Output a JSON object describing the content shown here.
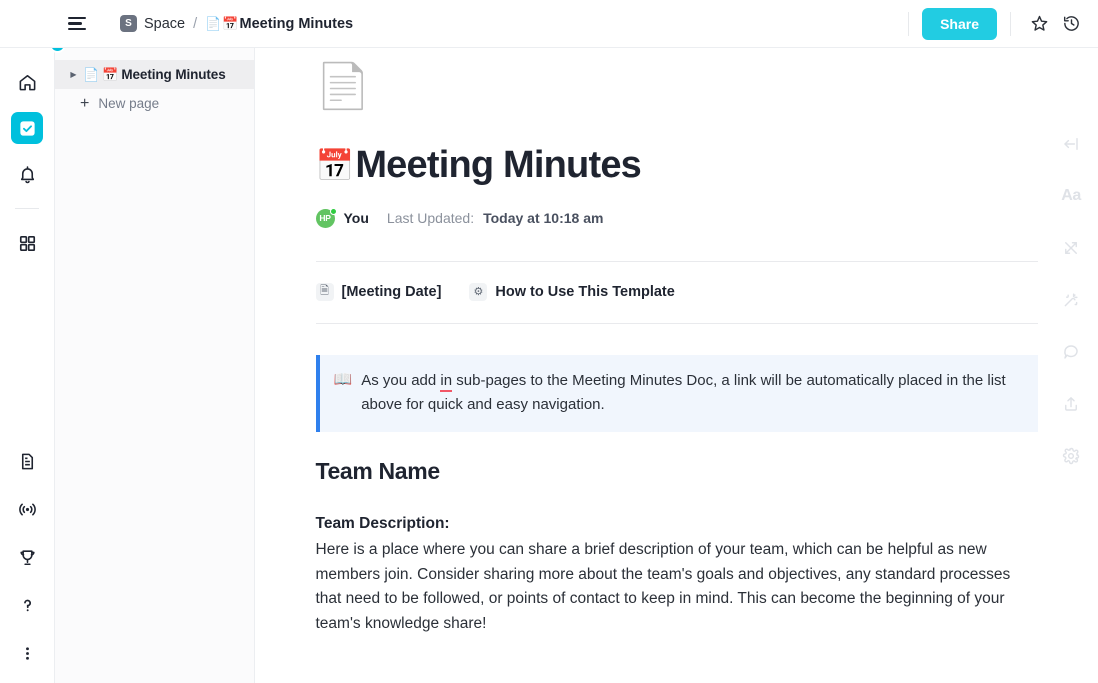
{
  "app": {
    "logo_name": "clickup-logo",
    "accent": "#00c0dd",
    "badge_glyph": "›"
  },
  "topbar": {
    "menu_icon": "hamburger-icon",
    "space_badge": "S",
    "space_label": "Space",
    "separator": "/",
    "doc_emoji_page": "📄",
    "doc_emoji_cal": "📅",
    "doc_label": "Meeting Minutes",
    "share_label": "Share",
    "star_icon": "star-icon",
    "history_icon": "history-icon"
  },
  "rail": {
    "items": [
      {
        "name": "home",
        "icon": "home-icon",
        "active": false
      },
      {
        "name": "tasks",
        "icon": "check-square-icon",
        "active": true
      },
      {
        "name": "notifications",
        "icon": "bell-icon",
        "active": false
      },
      {
        "name": "dashboards",
        "icon": "grid-icon",
        "active": false
      }
    ],
    "bottom_items": [
      {
        "name": "docs",
        "icon": "document-icon"
      },
      {
        "name": "broadcast",
        "icon": "broadcast-icon"
      },
      {
        "name": "goals",
        "icon": "trophy-icon"
      },
      {
        "name": "help",
        "icon": "question-mark-icon"
      },
      {
        "name": "more",
        "icon": "more-vertical-icon"
      }
    ]
  },
  "sidebar": {
    "title": "Meeting Minutes",
    "search_icon": "search-icon",
    "collapse_icon": "collapse-left-icon",
    "tree": [
      {
        "caret": "▶",
        "emoji_page": "📄",
        "emoji_cal": "📅",
        "label": "Meeting Minutes",
        "selected": true
      }
    ],
    "new_page_label": "New page",
    "new_page_icon": "plus-icon"
  },
  "doc": {
    "cover_emoji": "📄",
    "title_emoji": "📅",
    "title": "Meeting Minutes",
    "avatar_initials": "HP",
    "author": "You",
    "updated_label": "Last Updated:",
    "updated_value": "Today at 10:18 am",
    "sub_links": [
      {
        "icon": "page-icon",
        "glyph": "🗎",
        "label": "[Meeting Date]"
      },
      {
        "icon": "gear-emoji-icon",
        "glyph": "⚙",
        "label": "How to Use This Template"
      }
    ],
    "callout": {
      "emoji": "📖",
      "text_before": "As you add ",
      "text_error": "in",
      "text_after": " sub-pages to the Meeting Minutes Doc, a link will be automatically placed in the list above for quick and easy navigation.",
      "accent": "#2f80ed",
      "background": "#f1f6fd"
    },
    "heading_team_name": "Team Name",
    "team_description_label": "Team Description:",
    "team_description_body": "Here is a place where you can share a brief description of your team, which can be helpful as new members join. Consider sharing more about the team's goals and objectives, any standard processes that need to be followed, or points of contact to keep in mind. This can become the beginning of your team's knowledge share!"
  },
  "right_rail": {
    "items": [
      {
        "name": "collapse-panel",
        "icon": "arrow-left-bar-icon"
      },
      {
        "name": "typography",
        "icon": "font-size-icon",
        "glyph": "Aa"
      },
      {
        "name": "relationships",
        "icon": "shuffle-arrows-icon"
      },
      {
        "name": "ai-assist",
        "icon": "magic-wand-icon"
      },
      {
        "name": "comments",
        "icon": "comment-bubble-icon"
      },
      {
        "name": "share-export",
        "icon": "upload-icon"
      },
      {
        "name": "settings",
        "icon": "gear-icon"
      }
    ]
  }
}
